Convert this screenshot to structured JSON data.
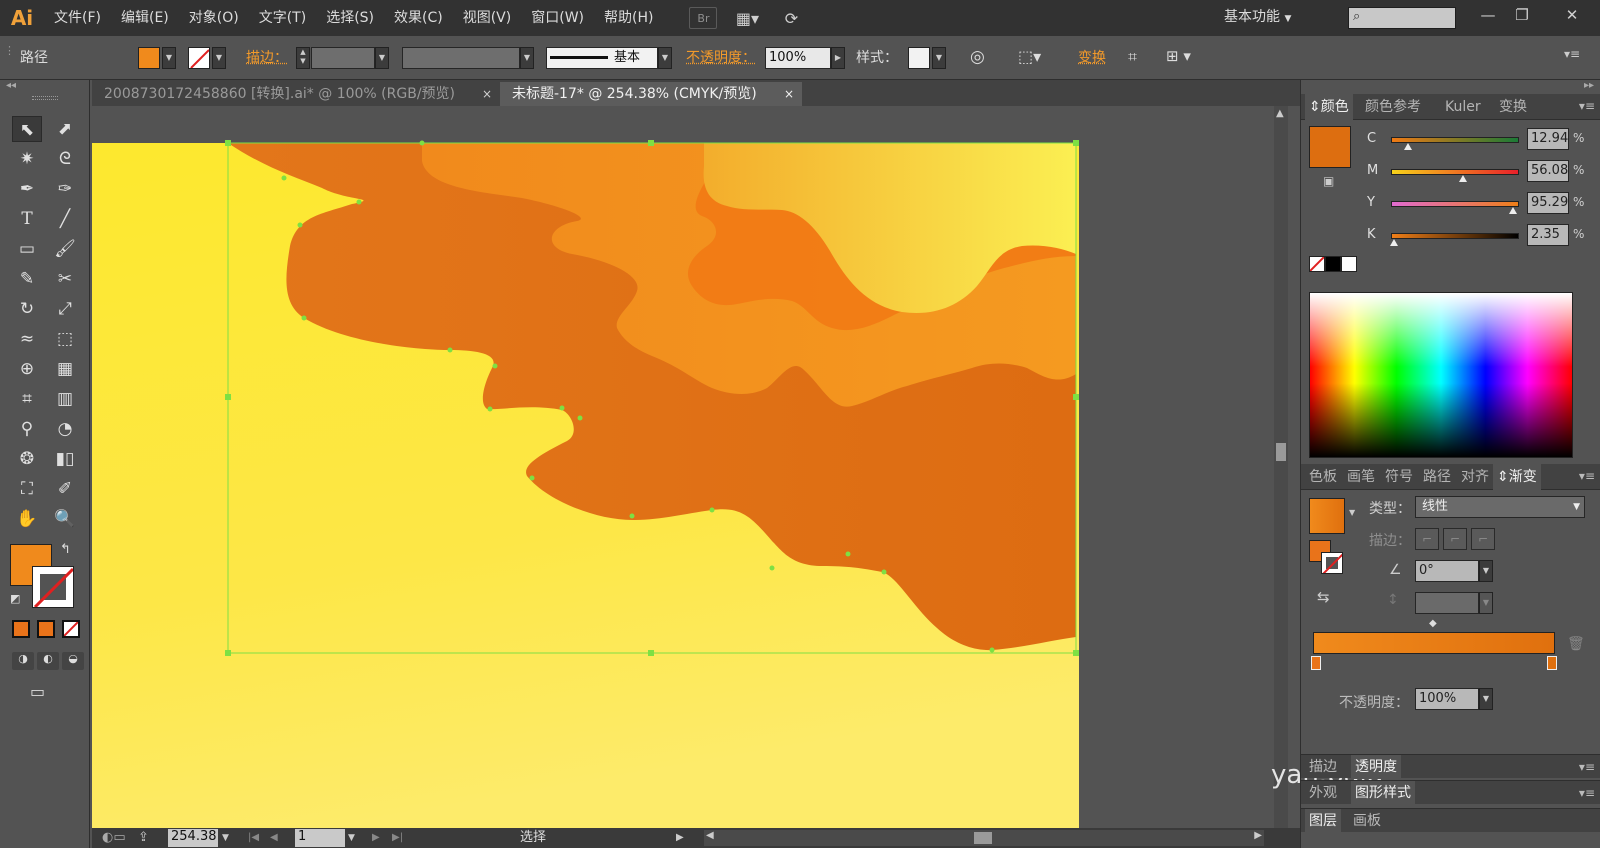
{
  "app": {
    "logo": "Ai",
    "menus": [
      "文件(F)",
      "编辑(E)",
      "对象(O)",
      "文字(T)",
      "选择(S)",
      "效果(C)",
      "视图(V)",
      "窗口(W)",
      "帮助(H)"
    ],
    "bridge_label": "Br",
    "workspace": "基本功能",
    "search_glyph": "⌕"
  },
  "control": {
    "object_type": "路径",
    "fill_color": "#f08a1c",
    "stroke_label": "描边：",
    "stroke_style": "基本",
    "opacity_label": "不透明度：",
    "opacity_value": "100%",
    "style_label": "样式：",
    "transform_label": "变换"
  },
  "tabs": [
    {
      "title": "2008730172458860 [转换].ai* @ 100% (RGB/预览)",
      "close": "×",
      "active": false
    },
    {
      "title": "未标题-17* @ 254.38% (CMYK/预览)",
      "close": "×",
      "active": true
    }
  ],
  "status": {
    "zoom": "254.38",
    "page": "1",
    "tool_name": "选择"
  },
  "color_panel": {
    "tabs": [
      "颜色",
      "颜色参考",
      "Kuler",
      "变换"
    ],
    "swatch": "#dd6e10",
    "channels": [
      {
        "label": "C",
        "value": "12.94",
        "fraction": 0.13,
        "from": "#f07a14",
        "to": "#1b7a36"
      },
      {
        "label": "M",
        "value": "56.08",
        "fraction": 0.56,
        "from": "#f7d21a",
        "to": "#e8202a"
      },
      {
        "label": "Y",
        "value": "95.29",
        "fraction": 0.95,
        "from": "#e06bd0",
        "to": "#ee7f18"
      },
      {
        "label": "K",
        "value": "2.35",
        "fraction": 0.02,
        "from": "#f07f18",
        "to": "#000000"
      }
    ],
    "pct": "%"
  },
  "gradient_panel": {
    "tabs": [
      "色板",
      "画笔",
      "符号",
      "路径",
      "对齐",
      "渐变"
    ],
    "type_label": "类型：",
    "type_value": "线性",
    "stroke_label": "描边：",
    "angle_value": "0°",
    "opacity_label": "不透明度：",
    "opacity_value": "100%",
    "gradient_from": "#f08a1c",
    "gradient_to": "#e0700e"
  },
  "bottom_panels": {
    "row1": [
      "描边",
      "透明度"
    ],
    "row2": [
      "外观",
      "图形样式"
    ],
    "row3": [
      "图层",
      "画板"
    ]
  },
  "watermark": "yan.baid"
}
